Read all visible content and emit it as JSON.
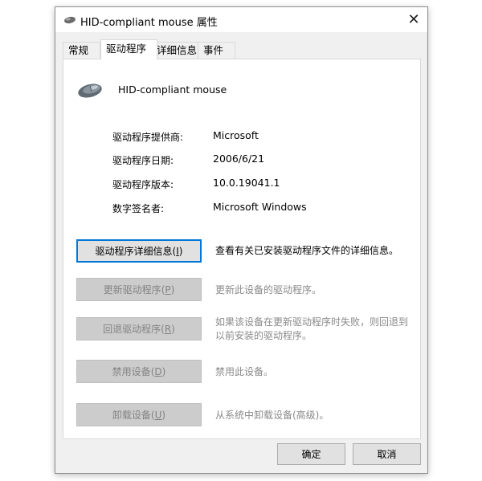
{
  "window": {
    "title": "HID-compliant mouse 属性",
    "close_glyph": "✕"
  },
  "tabs": [
    {
      "label": "常规"
    },
    {
      "label": "驱动程序"
    },
    {
      "label": "详细信息"
    },
    {
      "label": "事件"
    }
  ],
  "device": {
    "name": "HID-compliant mouse",
    "icon": "mouse-icon"
  },
  "info": [
    {
      "label": "驱动程序提供商:",
      "value": "Microsoft"
    },
    {
      "label": "驱动程序日期:",
      "value": "2006/6/21"
    },
    {
      "label": "驱动程序版本:",
      "value": "10.0.19041.1"
    },
    {
      "label": "数字签名者:",
      "value": "Microsoft Windows"
    }
  ],
  "actions": [
    {
      "label": "驱动程序详细信息",
      "hotkey": "I",
      "desc": "查看有关已安装驱动程序文件的详细信息。",
      "enabled": true
    },
    {
      "label": "更新驱动程序",
      "hotkey": "P",
      "desc": "更新此设备的驱动程序。",
      "enabled": false
    },
    {
      "label": "回退驱动程序",
      "hotkey": "R",
      "desc": "如果该设备在更新驱动程序时失败，则回退到以前安装的驱动程序。",
      "desc_line1": "如果该设备在更新驱动程序时失败，则回退到",
      "desc_line2": "以前安装的驱动程序。",
      "enabled": false
    },
    {
      "label": "禁用设备",
      "hotkey": "D",
      "desc": "禁用此设备。",
      "enabled": false
    },
    {
      "label": "卸载设备",
      "hotkey": "U",
      "desc": "从系统中卸载设备(高级)。",
      "enabled": false
    }
  ],
  "footer": {
    "ok_label": "确定",
    "cancel_label": "取消"
  },
  "colors": {
    "accent": "#0078d7",
    "disabled_button": "#cccccc",
    "disabled_text": "#838383"
  }
}
